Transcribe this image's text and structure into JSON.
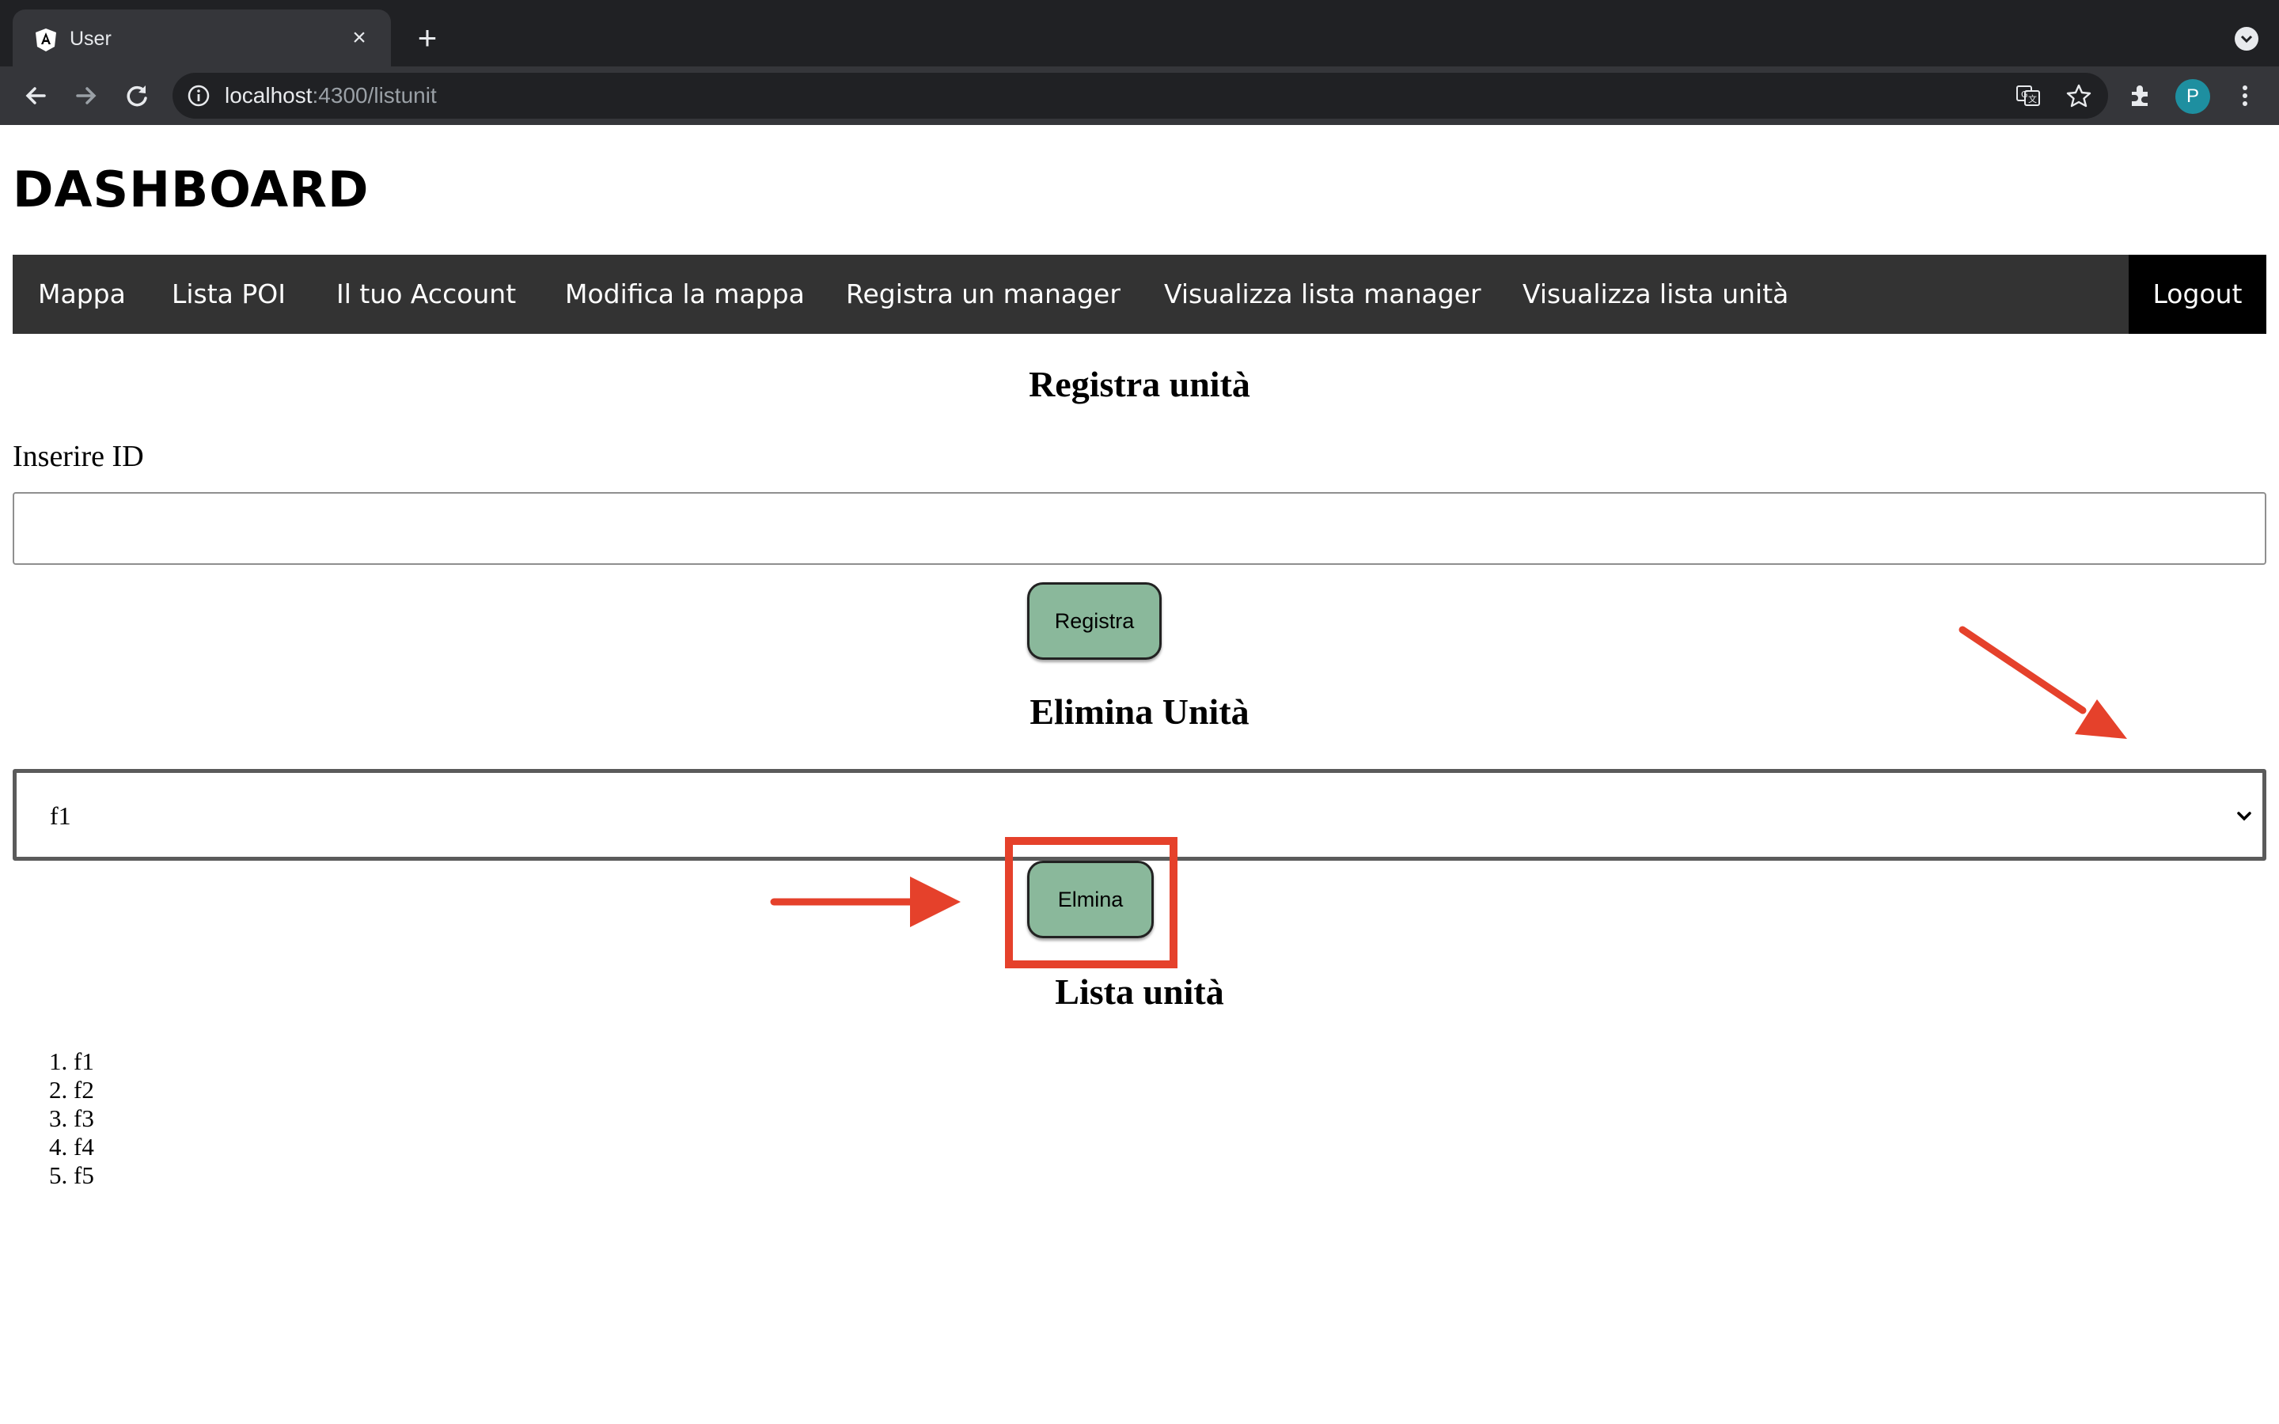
{
  "browser": {
    "tab_title": "User",
    "url_host": "localhost",
    "url_rest": ":4300/listunit",
    "profile_initial": "P",
    "icons": [
      "angular-favicon-icon",
      "close-icon",
      "plus-icon",
      "tab-search-icon",
      "back-arrow-icon",
      "forward-arrow-icon",
      "reload-icon",
      "info-icon",
      "translate-icon",
      "star-icon",
      "extensions-icon",
      "kebab-menu-icon"
    ]
  },
  "page": {
    "title": "DASHBOARD",
    "nav": {
      "items": [
        "Mappa",
        "Lista POI",
        "Il tuo Account",
        "Modifica la mappa",
        "Registra un manager",
        "Visualizza lista manager",
        "Visualizza lista unità"
      ],
      "logout": "Logout"
    },
    "register": {
      "heading": "Registra unità",
      "label": "Inserire ID",
      "input_value": "",
      "button": "Registra"
    },
    "delete": {
      "heading": "Elimina Unità",
      "selected": "f1",
      "button": "Elmina"
    },
    "list": {
      "heading": "Lista unità",
      "items": [
        "1. f1",
        "2. f2",
        "3. f3",
        "4. f4",
        "5. f5"
      ]
    }
  },
  "colors": {
    "nav_bg": "#333333",
    "logout_bg": "#000000",
    "button_bg": "#8ab89b",
    "annotation": "#e5412b"
  }
}
